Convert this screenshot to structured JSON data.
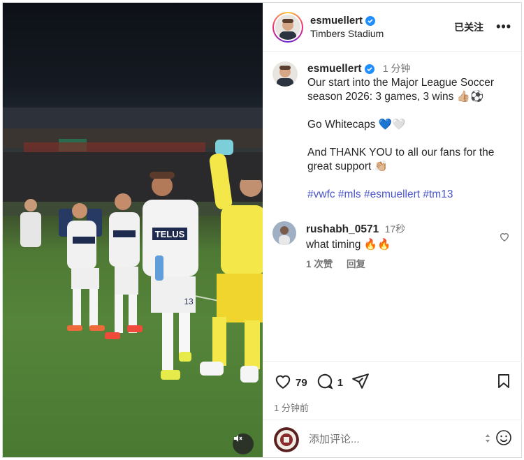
{
  "colors": {
    "accent": "#4a55c9",
    "verified": "#1f8fff",
    "muted": "#737373",
    "border": "#dbdbdb"
  },
  "header": {
    "username": "esmuellert",
    "location": "Timbers Stadium",
    "follow_state": "已关注",
    "more": "•••"
  },
  "caption": {
    "username": "esmuellert",
    "time": "1 分钟",
    "line1": "Our start into the Major League Soccer",
    "line2": "season 2026: 3 games, 3 wins 👍🏼⚽",
    "line3": "Go Whitecaps 💙🤍",
    "line4": "And THANK YOU to all our fans for the",
    "line5": "great support 👏🏼",
    "hashtags": "#vwfc #mls #esmuellert #tm13"
  },
  "comments": [
    {
      "username": "rushabh_0571",
      "time": "17秒",
      "text": "what timing 🔥🔥",
      "likes": "1 次赞",
      "reply": "回复"
    }
  ],
  "actions": {
    "likes": "79",
    "comments": "1",
    "posted": "1 分钟前"
  },
  "composer": {
    "placeholder": "添加评论..."
  },
  "media": {
    "shirt_text": "TELUS",
    "shirt_number": "13"
  },
  "icons": [
    "verified-badge-icon",
    "more-icon",
    "heart-icon",
    "comment-icon",
    "share-icon",
    "bookmark-icon",
    "mute-icon",
    "emoji-icon",
    "sort-icon"
  ]
}
